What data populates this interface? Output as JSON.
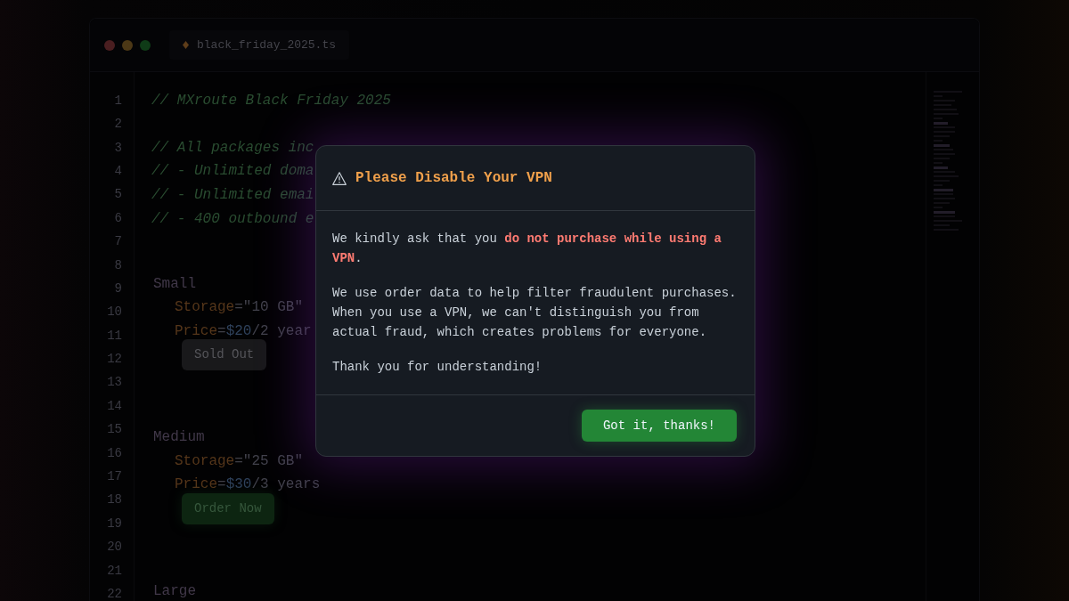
{
  "editor": {
    "window_controls": [
      {
        "color": "#4a1e20"
      },
      {
        "color": "#4c3816"
      },
      {
        "color": "#0f3b17"
      }
    ],
    "tab": {
      "filename": "black_friday_2025.ts"
    },
    "line_numbers": [
      "1",
      "2",
      "3",
      "4",
      "5",
      "6",
      "7",
      "8",
      "9",
      "10",
      "11",
      "12",
      "13",
      "14",
      "15",
      "16",
      "17",
      "18",
      "19",
      "20",
      "21",
      "22"
    ],
    "comment_blocks": [
      [
        "// MXroute Black Friday 2025"
      ],
      [
        "// All packages inc",
        "// - Unlimited doma",
        "// - Unlimited emai",
        "// - 400 outbound e"
      ]
    ],
    "plans": [
      {
        "name": "Small",
        "lines": [
          [
            {
              "kind": "key",
              "text": "Storage"
            },
            {
              "kind": "op",
              "text": "="
            },
            {
              "kind": "string",
              "text": "\"10 GB\""
            }
          ],
          [
            {
              "kind": "key",
              "text": "Price"
            },
            {
              "kind": "op",
              "text": "="
            },
            {
              "kind": "number",
              "text": "$20"
            },
            {
              "kind": "plain",
              "text": "/2 year"
            }
          ]
        ],
        "button": {
          "label": "Sold Out",
          "disabled": true
        }
      },
      {
        "name": "Medium",
        "lines": [
          [
            {
              "kind": "key",
              "text": "Storage"
            },
            {
              "kind": "op",
              "text": "="
            },
            {
              "kind": "string",
              "text": "\"25 GB\""
            }
          ],
          [
            {
              "kind": "key",
              "text": "Price"
            },
            {
              "kind": "op",
              "text": "="
            },
            {
              "kind": "number",
              "text": "$30"
            },
            {
              "kind": "plain",
              "text": "/3 years"
            }
          ]
        ],
        "button": {
          "label": "Order Now",
          "disabled": false
        }
      },
      {
        "name": "Large"
      }
    ]
  },
  "modal": {
    "title": "Please Disable Your VPN",
    "paragraphs": [
      "We kindly ask that you **do not purchase while using a VPN**.",
      "We use order data to help filter fraudulent purchases. When you use a VPN, we can't distinguish you from actual fraud, which creates problems for everyone.",
      "Thank you for understanding!"
    ],
    "button": "Got it, thanks!"
  }
}
